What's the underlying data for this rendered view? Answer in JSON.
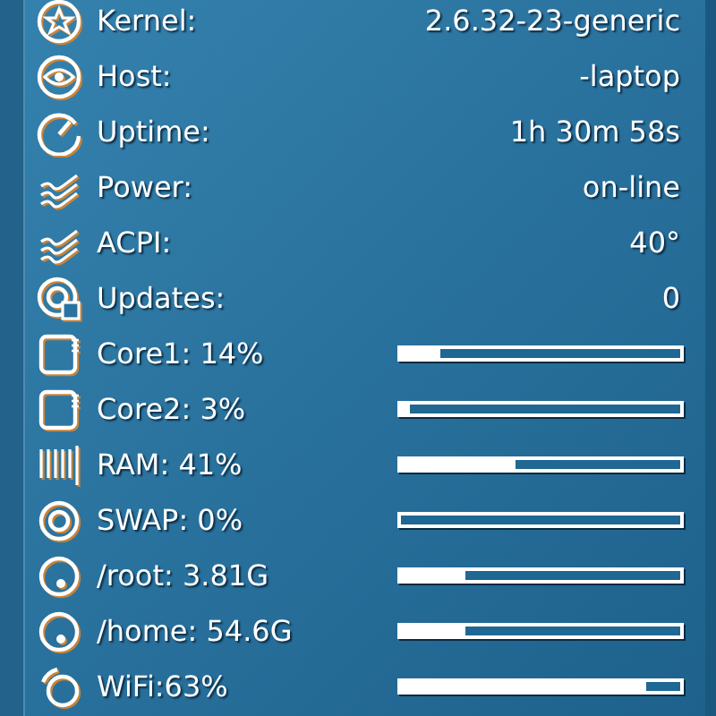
{
  "rows": [
    {
      "kind": "info",
      "label": "Kernel:",
      "value": "2.6.32-23-generic"
    },
    {
      "kind": "info",
      "label": "Host:",
      "value": "-laptop"
    },
    {
      "kind": "info",
      "label": "Uptime:",
      "value": "1h 30m 58s"
    },
    {
      "kind": "info",
      "label": "Power:",
      "value": "on-line"
    },
    {
      "kind": "info",
      "label": "ACPI:",
      "value": "40°"
    },
    {
      "kind": "info",
      "label": "Updates:",
      "value": "0"
    },
    {
      "kind": "bar",
      "label": "Core1: 14%",
      "level": 0.14
    },
    {
      "kind": "bar",
      "label": "Core2: 3%",
      "level": 0.03
    },
    {
      "kind": "bar",
      "label": "RAM: 41%",
      "level": 0.41
    },
    {
      "kind": "bar",
      "label": "SWAP: 0%",
      "level": 0
    },
    {
      "kind": "bar",
      "label": "/root: 3.81G",
      "level": 0.23
    },
    {
      "kind": "bar",
      "label": "/home: 54.6G",
      "level": 0.23
    },
    {
      "kind": "bar",
      "label": "WiFi:63%",
      "level": 0.88
    }
  ]
}
